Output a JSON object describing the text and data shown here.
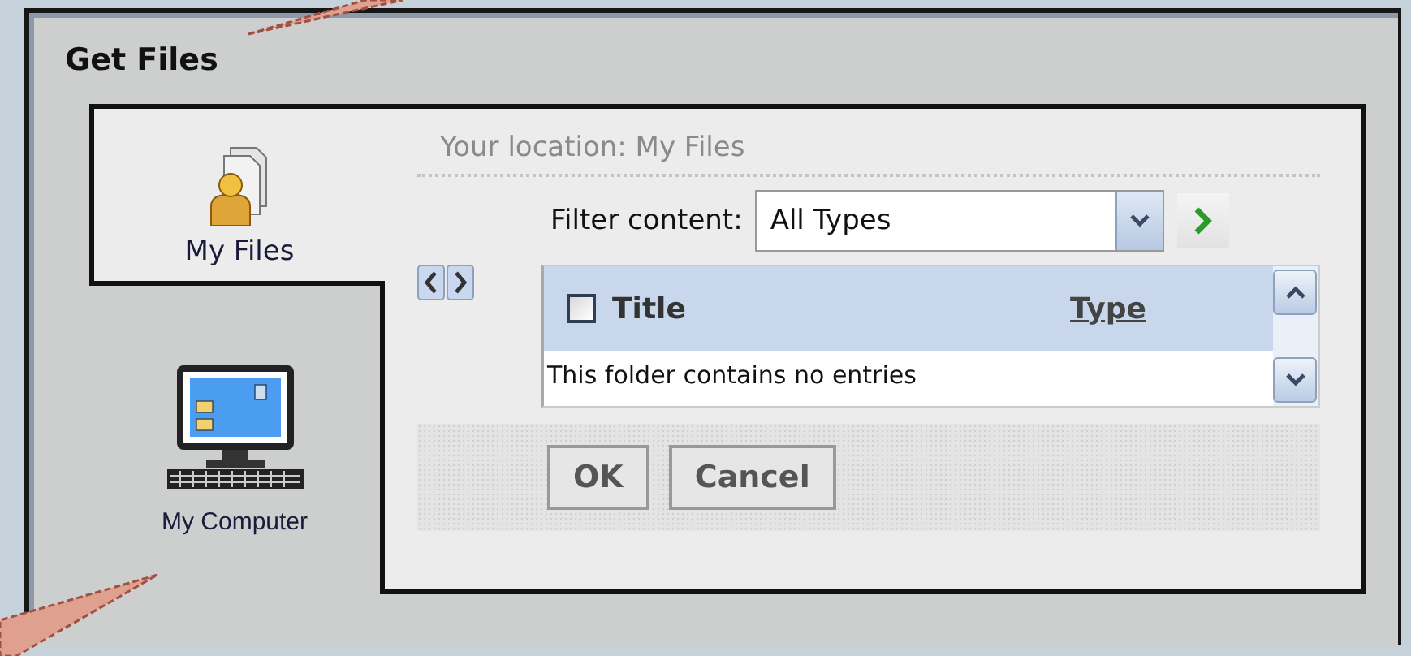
{
  "title": "Get Files",
  "locations": [
    {
      "label": "My Files",
      "kind": "files",
      "selected": true
    },
    {
      "label": "My Computer",
      "kind": "computer",
      "selected": false
    }
  ],
  "location_text": "Your location: My Files",
  "filter": {
    "label": "Filter content:",
    "value": "All Types"
  },
  "table": {
    "columns": [
      {
        "label": "Title",
        "kind": "checkbox",
        "checked": false
      },
      {
        "label": "Type",
        "kind": "link"
      }
    ],
    "empty_message": "This folder contains no entries"
  },
  "buttons": [
    "OK",
    "Cancel"
  ]
}
